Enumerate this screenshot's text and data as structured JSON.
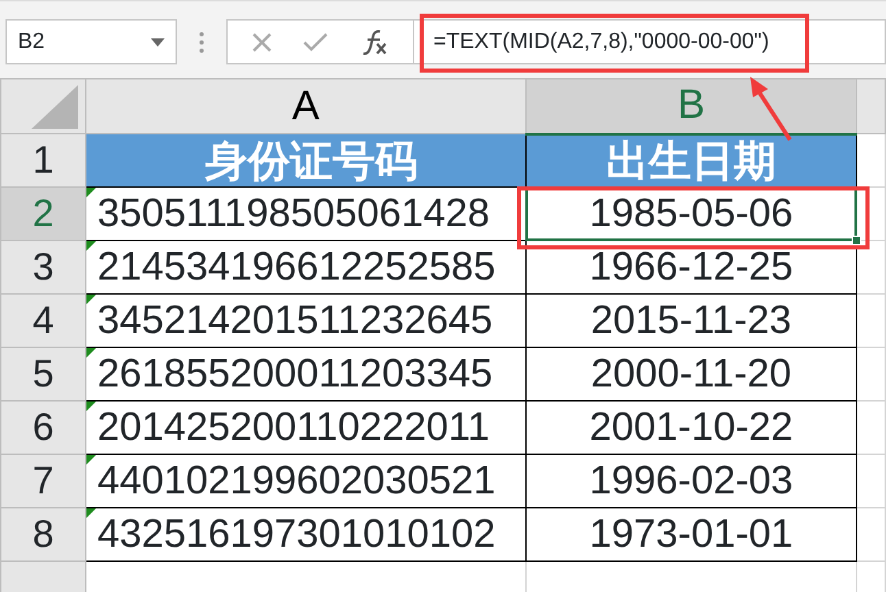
{
  "formula_bar": {
    "name_box": "B2",
    "formula": "=TEXT(MID(A2,7,8),\"0000-00-00\")"
  },
  "columns": [
    {
      "label": "A",
      "selected": false
    },
    {
      "label": "B",
      "selected": true
    }
  ],
  "rows": [
    {
      "number": "1",
      "selected": false,
      "kind": "header",
      "cells": [
        {
          "text": "身份证号码",
          "selected": false
        },
        {
          "text": "出生日期",
          "selected": false
        }
      ]
    },
    {
      "number": "2",
      "selected": true,
      "kind": "data",
      "cells": [
        {
          "text": "350511198505061428",
          "flagged": true,
          "selected": false
        },
        {
          "text": "1985-05-06",
          "selected": true
        }
      ]
    },
    {
      "number": "3",
      "selected": false,
      "kind": "data",
      "cells": [
        {
          "text": "214534196612252585",
          "flagged": true,
          "selected": false
        },
        {
          "text": "1966-12-25",
          "selected": false
        }
      ]
    },
    {
      "number": "4",
      "selected": false,
      "kind": "data",
      "cells": [
        {
          "text": "345214201511232645",
          "flagged": true,
          "selected": false
        },
        {
          "text": "2015-11-23",
          "selected": false
        }
      ]
    },
    {
      "number": "5",
      "selected": false,
      "kind": "data",
      "cells": [
        {
          "text": "261855200011203345",
          "flagged": true,
          "selected": false
        },
        {
          "text": "2000-11-20",
          "selected": false
        }
      ]
    },
    {
      "number": "6",
      "selected": false,
      "kind": "data",
      "cells": [
        {
          "text": "201425200110222011",
          "flagged": true,
          "selected": false
        },
        {
          "text": "2001-10-22",
          "selected": false
        }
      ]
    },
    {
      "number": "7",
      "selected": false,
      "kind": "data",
      "cells": [
        {
          "text": "440102199602030521",
          "flagged": true,
          "selected": false
        },
        {
          "text": "1996-02-03",
          "selected": false
        }
      ]
    },
    {
      "number": "8",
      "selected": false,
      "kind": "data",
      "cells": [
        {
          "text": "432516197301010102",
          "flagged": true,
          "selected": false
        },
        {
          "text": "1973-01-01",
          "selected": false
        }
      ]
    }
  ]
}
